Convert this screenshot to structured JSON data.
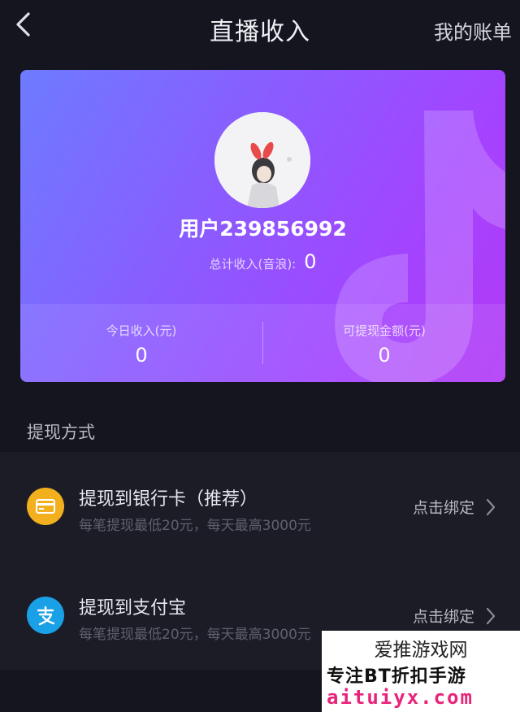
{
  "header": {
    "title": "直播收入",
    "bill_link": "我的账单",
    "back_icon": "chevron-left-icon"
  },
  "card": {
    "username": "用户239856992",
    "total_label": "总计收入(音浪):",
    "total_value": "0",
    "today_label": "今日收入(元)",
    "today_value": "0",
    "withdrawable_label": "可提现金额(元)",
    "withdrawable_value": "0",
    "gradient_colors": [
      "#6d7bff",
      "#8a5cff",
      "#a443ff",
      "#b23af5"
    ]
  },
  "section": {
    "title": "提现方式"
  },
  "methods": [
    {
      "icon": "bank-card-icon",
      "icon_color": "#f2b01e",
      "title": "提现到银行卡（推荐）",
      "subtitle": "每笔提现最低20元，每天最高3000元",
      "action": "点击绑定"
    },
    {
      "icon": "alipay-icon",
      "icon_color": "#1aa0e6",
      "title": "提现到支付宝",
      "subtitle": "每笔提现最低20元，每天最高3000元",
      "action": "点击绑定"
    }
  ],
  "watermark": {
    "line1": "爱推游戏网",
    "line2": "专注BT折扣手游",
    "line3": "aituiyx.com"
  }
}
